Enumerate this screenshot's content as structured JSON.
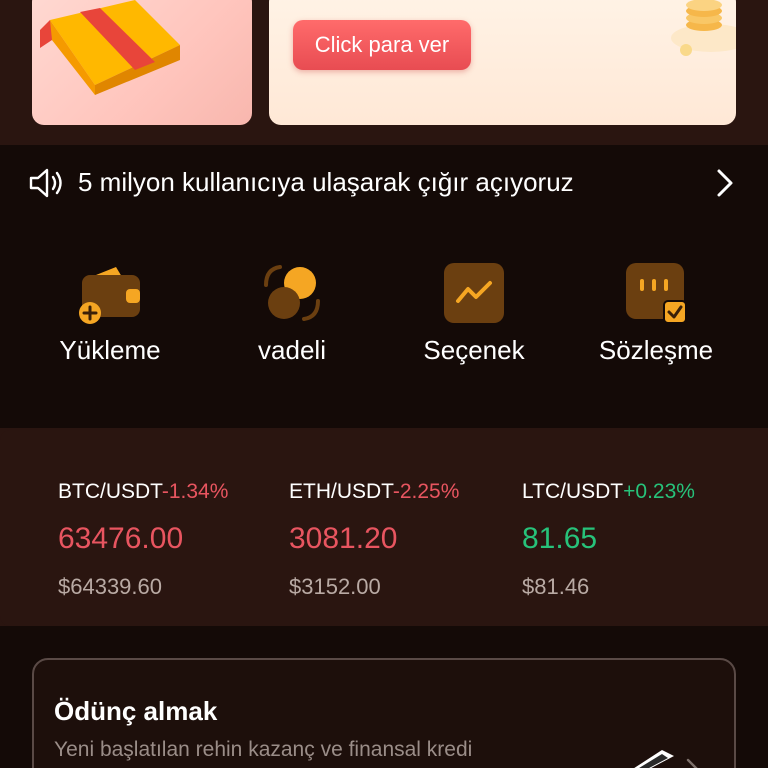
{
  "banner": {
    "cta_label": "Click para ver"
  },
  "announcement": {
    "text": "5 milyon kullanıcıya ulaşarak çığır açıyoruz"
  },
  "actions": [
    {
      "label": "Yükleme",
      "icon": "wallet-add-icon"
    },
    {
      "label": "vadeli",
      "icon": "futures-swap-icon"
    },
    {
      "label": "Seçenek",
      "icon": "trend-chart-icon"
    },
    {
      "label": "Sözleşme",
      "icon": "contract-check-icon"
    }
  ],
  "tickers": [
    {
      "pair": "BTC/USDT",
      "change": "-1.34%",
      "price": "63476.00",
      "usd": "$64339.60",
      "trend": "down"
    },
    {
      "pair": "ETH/USDT",
      "change": "-2.25%",
      "price": "3081.20",
      "usd": "$3152.00",
      "trend": "down"
    },
    {
      "pair": "LTC/USDT",
      "change": "+0.23%",
      "price": "81.65",
      "usd": "$81.46",
      "trend": "up"
    }
  ],
  "loan": {
    "title": "Ödünç almak",
    "subtitle": "Yeni başlatılan rehin kazanç ve finansal kredi"
  },
  "colors": {
    "accent": "#f5a623",
    "negative": "#e85560",
    "positive": "#27c27a",
    "cta": "#e84c52"
  }
}
